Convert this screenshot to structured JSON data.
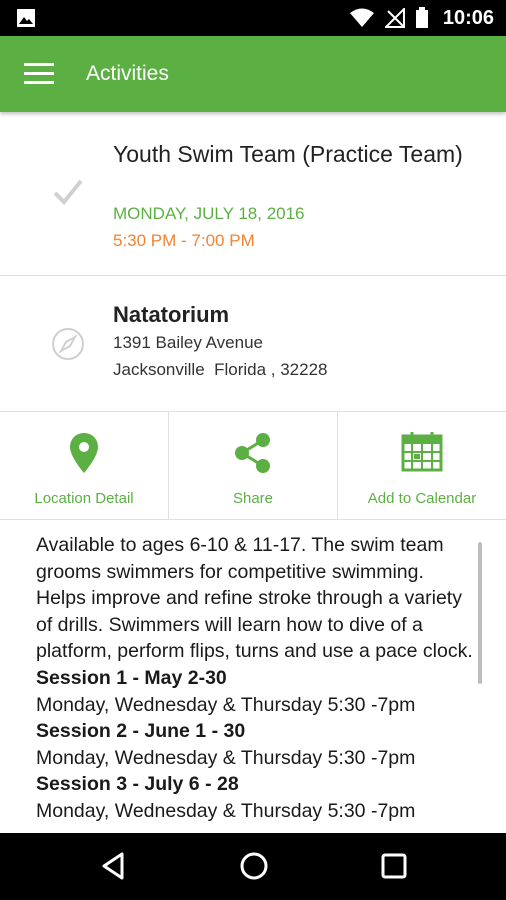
{
  "status_bar": {
    "time": "10:06",
    "icons": [
      "image-icon",
      "wifi-icon",
      "no-signal-icon",
      "battery-icon"
    ]
  },
  "app_bar": {
    "title": "Activities",
    "menu_icon": "hamburger-menu-icon",
    "color": "#5cb043"
  },
  "event": {
    "name": "Youth Swim Team (Practice Team)",
    "date": "MONDAY, JULY 18, 2016",
    "time": "5:30 PM - 7:00 PM",
    "date_color": "#5cb043",
    "time_color": "#f08433"
  },
  "location": {
    "venue": "Natatorium",
    "address_line1": "1391 Bailey Avenue",
    "address_line2": "Jacksonville  Florida , 32228"
  },
  "actions": [
    {
      "label": "Location Detail",
      "icon": "location-pin-icon"
    },
    {
      "label": "Share",
      "icon": "share-icon"
    },
    {
      "label": "Add to Calendar",
      "icon": "calendar-icon"
    }
  ],
  "description": {
    "intro": "Available to ages 6-10 & 11-17. The swim team grooms swimmers for competitive swimming. Helps improve and refine stroke through a variety of drills. Swimmers will learn how to dive of a platform, perform flips, turns and use a pace clock.",
    "sessions": [
      {
        "title": "Session 1 - May 2-30",
        "schedule": "Monday, Wednesday & Thursday 5:30 -7pm"
      },
      {
        "title": "Session 2 - June 1 - 30",
        "schedule": "Monday, Wednesday & Thursday 5:30 -7pm"
      },
      {
        "title": "Session 3 - July 6 - 28",
        "schedule": "Monday, Wednesday & Thursday 5:30 -7pm"
      }
    ]
  },
  "nav_bar": {
    "buttons": [
      "back-icon",
      "home-icon",
      "recents-icon"
    ]
  }
}
